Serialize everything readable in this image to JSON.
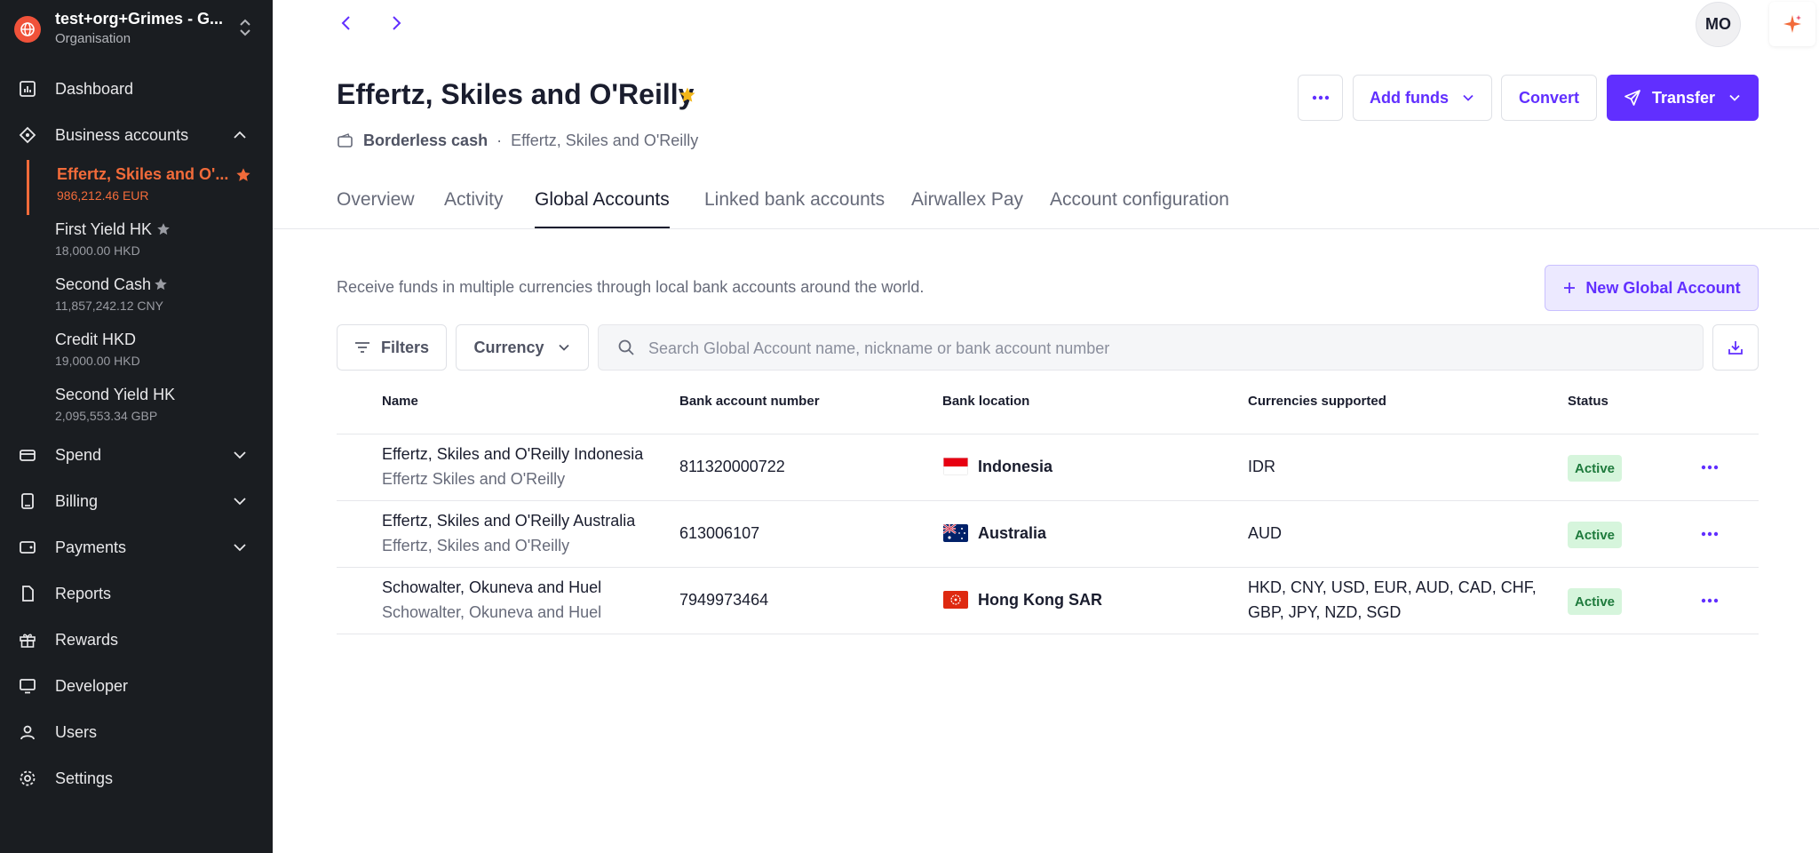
{
  "org": {
    "name": "test+org+Grimes - G...",
    "subtitle": "Organisation"
  },
  "nav": {
    "dashboard": "Dashboard",
    "business_accounts": "Business accounts",
    "spend": "Spend",
    "billing": "Billing",
    "payments": "Payments",
    "reports": "Reports",
    "rewards": "Rewards",
    "developer": "Developer",
    "users": "Users",
    "settings": "Settings"
  },
  "accounts": [
    {
      "name": "Effertz, Skiles and O'...",
      "balance": "986,212.46 EUR",
      "starred": true,
      "active": true
    },
    {
      "name": "First Yield HK",
      "balance": "18,000.00 HKD",
      "starred": true,
      "active": false
    },
    {
      "name": "Second Cash",
      "balance": "11,857,242.12 CNY",
      "starred": true,
      "active": false
    },
    {
      "name": "Credit HKD",
      "balance": "19,000.00 HKD",
      "starred": false,
      "active": false
    },
    {
      "name": "Second Yield HK",
      "balance": "2,095,553.34 GBP",
      "starred": false,
      "active": false
    }
  ],
  "header": {
    "avatar_initials": "MO",
    "title": "Effertz, Skiles and O'Reilly",
    "type": "Borderless cash",
    "separator": "·",
    "account_name": "Effertz, Skiles and O'Reilly",
    "add_funds": "Add funds",
    "convert": "Convert",
    "transfer": "Transfer"
  },
  "tabs": [
    "Overview",
    "Activity",
    "Global Accounts",
    "Linked bank accounts",
    "Airwallex Pay",
    "Account configuration"
  ],
  "active_tab": "Global Accounts",
  "global_accounts": {
    "description": "Receive funds in multiple currencies through local bank accounts around the world.",
    "new_button": "New Global Account",
    "filters": "Filters",
    "currency": "Currency",
    "search_placeholder": "Search Global Account name, nickname or bank account number"
  },
  "table": {
    "columns": [
      "Name",
      "Bank account number",
      "Bank location",
      "Currencies supported",
      "Status"
    ],
    "rows": [
      {
        "name": "Effertz, Skiles and O'Reilly Indonesia",
        "nickname": "Effertz Skiles and O'Reilly",
        "account_number": "811320000722",
        "location": "Indonesia",
        "currencies_line1": "IDR",
        "currencies_line2": "",
        "status": "Active"
      },
      {
        "name": "Effertz, Skiles and O'Reilly Australia",
        "nickname": "Effertz, Skiles and O'Reilly",
        "account_number": "613006107",
        "location": "Australia",
        "currencies_line1": "AUD",
        "currencies_line2": "",
        "status": "Active"
      },
      {
        "name": "Schowalter, Okuneva and Huel",
        "nickname": "Schowalter, Okuneva and Huel",
        "account_number": "7949973464",
        "location": "Hong Kong SAR",
        "currencies_line1": "HKD, CNY, USD, EUR, AUD, CAD, CHF,",
        "currencies_line2": "GBP, JPY, NZD, SGD",
        "status": "Active"
      }
    ]
  },
  "colors": {
    "sidebar_bg": "#1a1d21",
    "accent_orange": "#f26b3a",
    "primary_purple": "#612fff",
    "active_badge_bg": "#d6f5dc",
    "active_badge_text": "#1e7a3c"
  }
}
